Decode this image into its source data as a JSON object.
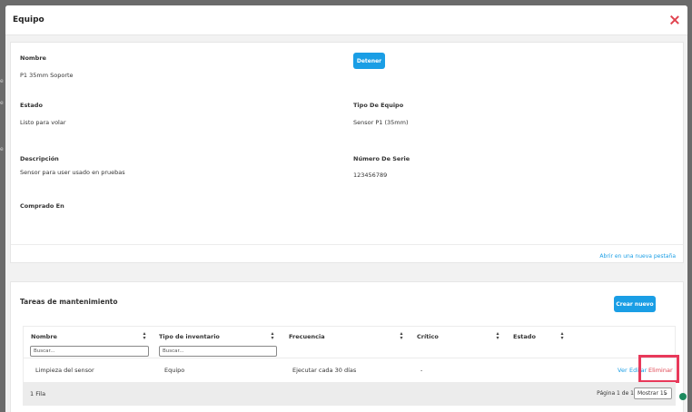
{
  "modal": {
    "title": "Equipo"
  },
  "details": {
    "nombre_label": "Nombre",
    "nombre_value": "P1 35mm Soporte",
    "detener_label": "Detener",
    "estado_label": "Estado",
    "estado_value": "Listo para volar",
    "tipo_label": "Tipo De Equipo",
    "tipo_value": "Sensor P1 (35mm)",
    "descripcion_label": "Descripción",
    "descripcion_value": "Sensor para user usado en pruebas",
    "serie_label": "Número De Serie",
    "serie_value": "123456789",
    "comprado_label": "Comprado En",
    "open_tab_link": "Abrir en una nueva pestaña"
  },
  "tasks": {
    "title": "Tareas de mantenimiento",
    "create_button": "Crear nuevo",
    "columns": [
      "Nombre",
      "Tipo de inventario",
      "Frecuencia",
      "Crítico",
      "Estado"
    ],
    "filter_placeholder": "Buscar...",
    "rows": [
      {
        "nombre": "Limpieza del sensor",
        "tipo": "Equipo",
        "frecuencia": "Ejecutar cada 30 días",
        "critico": "-",
        "estado": ""
      }
    ],
    "actions": {
      "view": "Ver",
      "edit": "Editar",
      "delete": "Eliminar"
    },
    "footer": {
      "row_count": "1 Fila",
      "page_info": "Página 1 de 1",
      "page_size": "Mostrar 15"
    }
  },
  "colors": {
    "primary": "#1a9ee5",
    "danger": "#e0434f",
    "highlight": "#e8395a",
    "status_dot": "#1c8a5e"
  }
}
